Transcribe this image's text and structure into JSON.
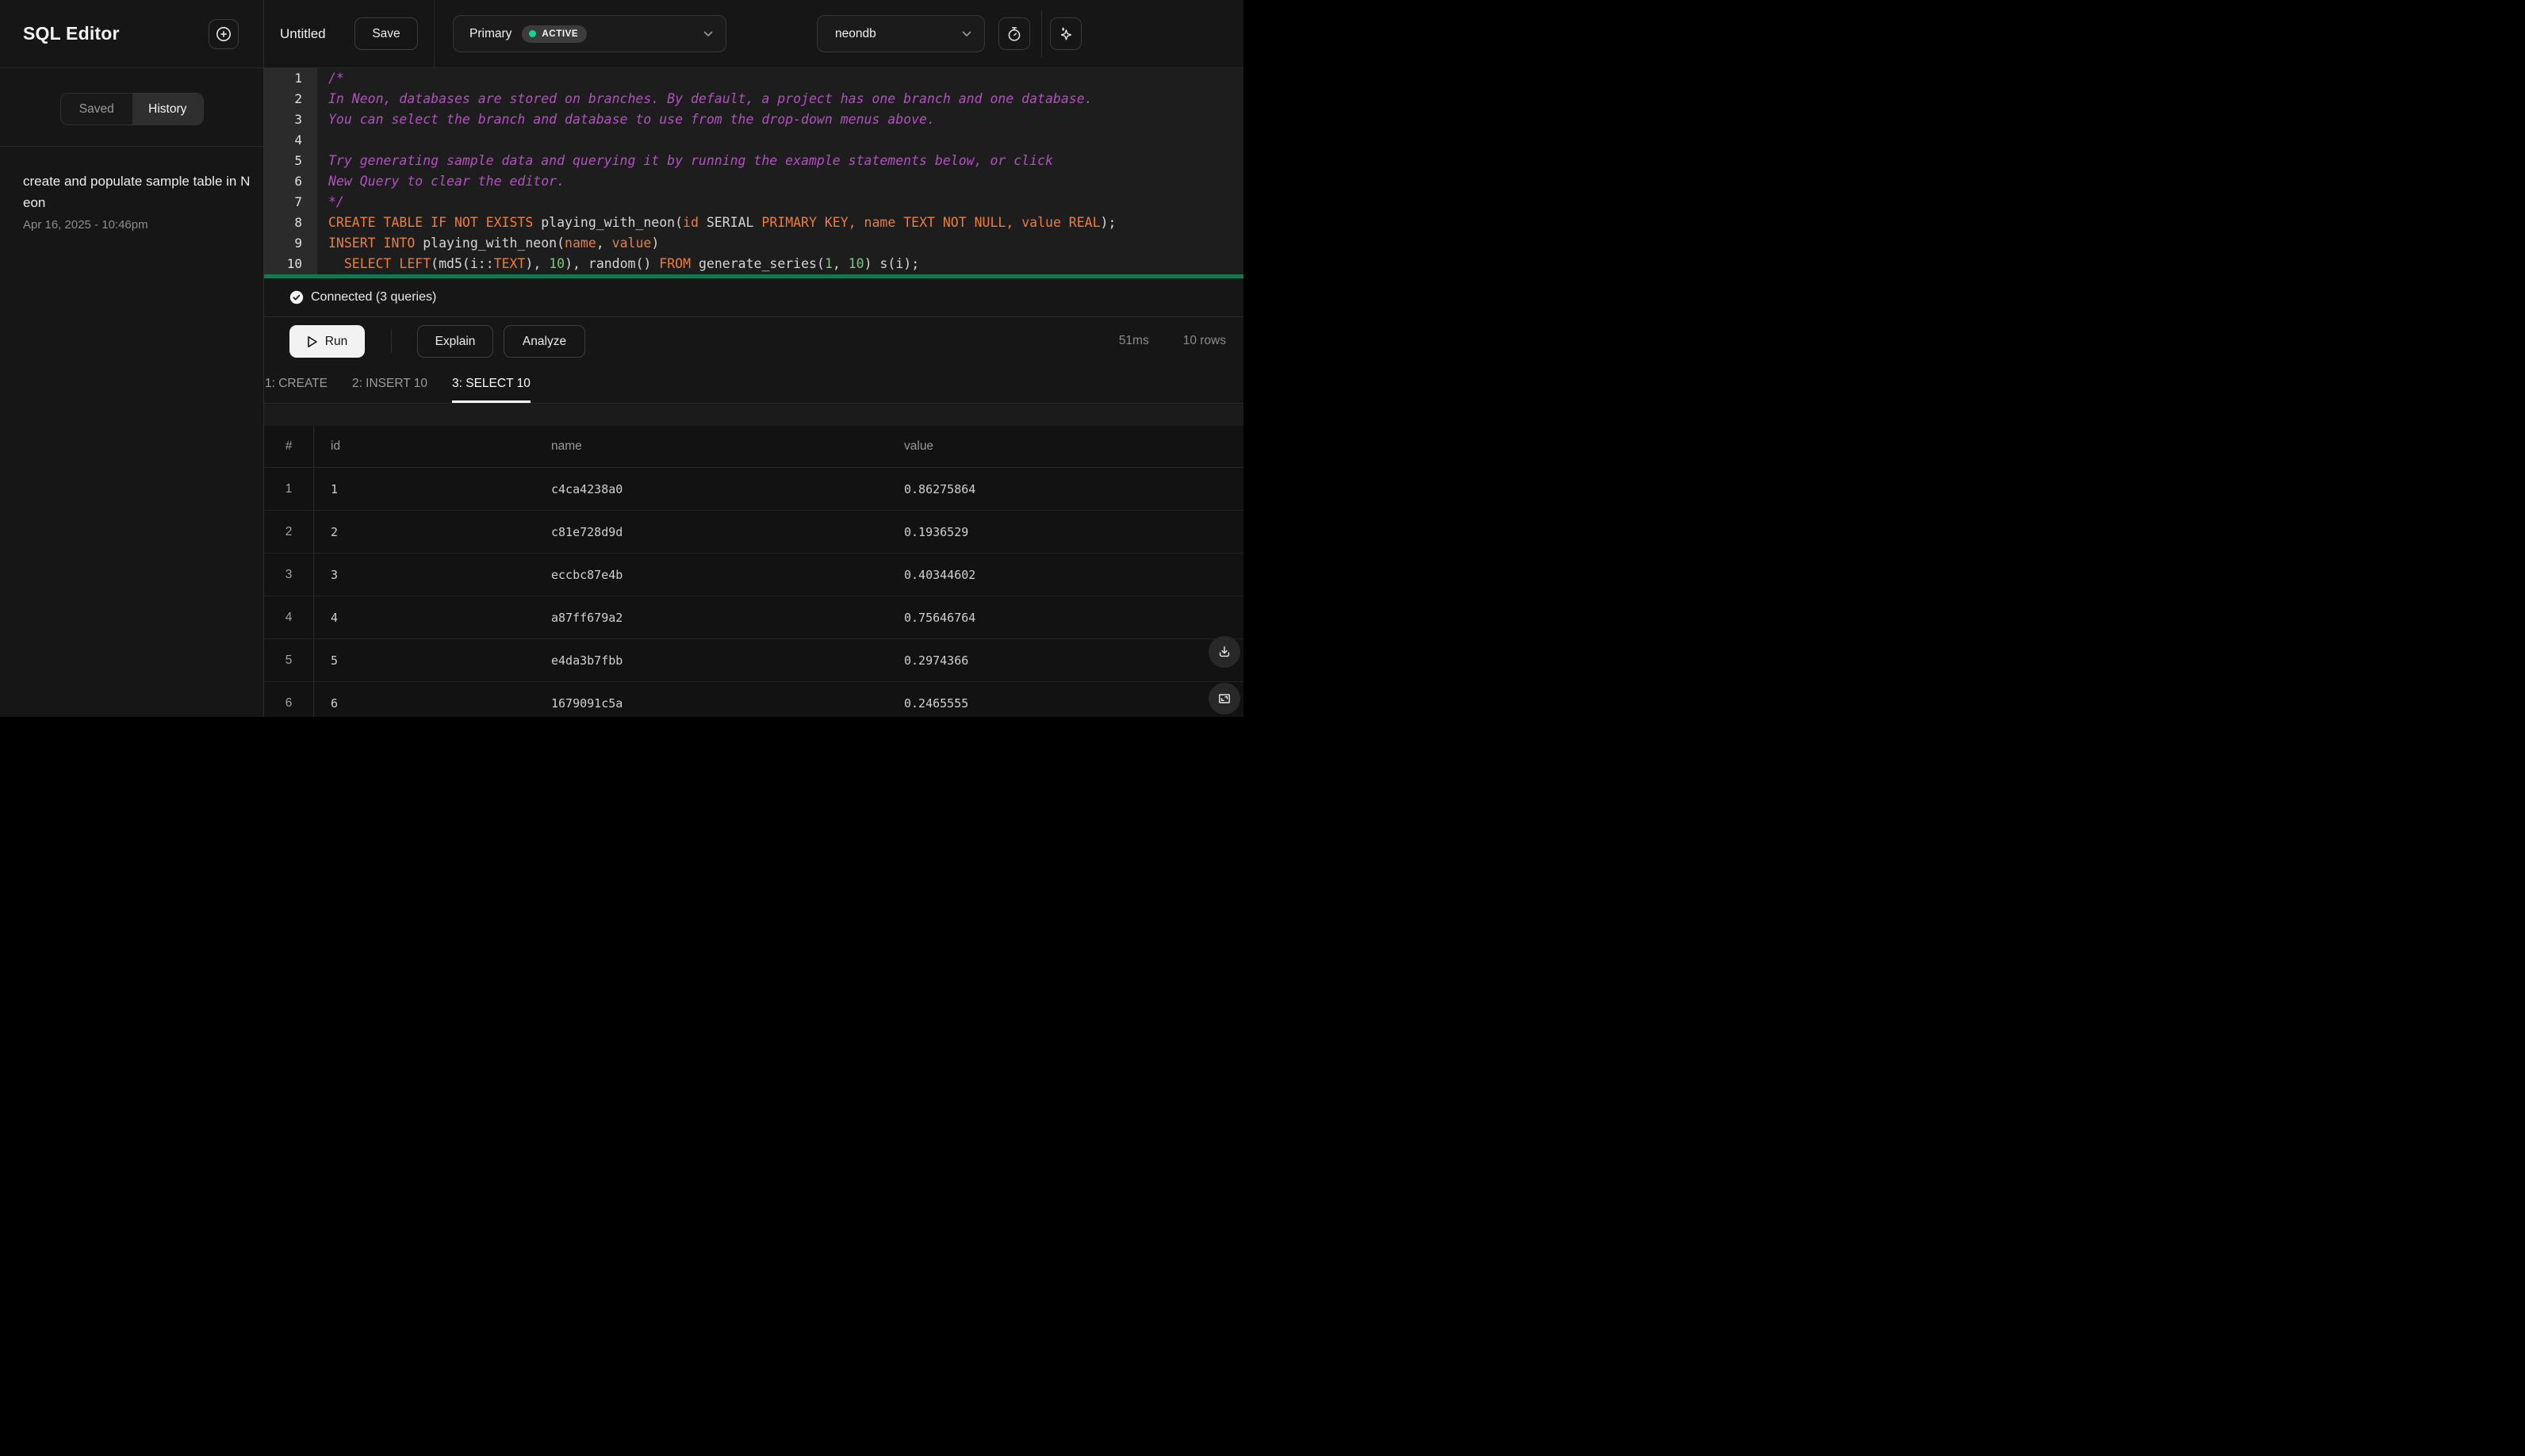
{
  "sidebar": {
    "title": "SQL Editor",
    "tabs": [
      {
        "label": "Saved",
        "active": false
      },
      {
        "label": "History",
        "active": true
      }
    ],
    "history_item": {
      "title": "create and populate sample table in Neon",
      "date": "Apr 16, 2025 - 10:46pm"
    }
  },
  "topbar": {
    "query_name": "Untitled",
    "save_label": "Save",
    "branch": {
      "name": "Primary",
      "status": "ACTIVE",
      "status_color": "#11d48d"
    },
    "database": {
      "name": "neondb"
    }
  },
  "editor": {
    "lines": [
      {
        "n": "1",
        "t": [
          [
            "c",
            "/*"
          ]
        ]
      },
      {
        "n": "2",
        "t": [
          [
            "c",
            "In Neon, databases are stored on branches. By default, a project has one branch and one database."
          ]
        ]
      },
      {
        "n": "3",
        "t": [
          [
            "c",
            "You can select the branch and database to use from the drop-down menus above."
          ]
        ]
      },
      {
        "n": "4",
        "t": []
      },
      {
        "n": "5",
        "t": [
          [
            "c",
            "Try generating sample data and querying it by running the example statements below, or click"
          ]
        ]
      },
      {
        "n": "6",
        "t": [
          [
            "c",
            "New Query to clear the editor."
          ]
        ]
      },
      {
        "n": "7",
        "t": [
          [
            "c",
            "*/"
          ]
        ]
      },
      {
        "n": "8",
        "t": [
          [
            "k",
            "CREATE TABLE IF NOT EXISTS"
          ],
          [
            "p",
            " playing_with_neon("
          ],
          [
            "k",
            "id"
          ],
          [
            "p",
            " SERIAL "
          ],
          [
            "k",
            "PRIMARY KEY, name TEXT NOT NULL, value REAL"
          ],
          [
            "p",
            ");"
          ]
        ]
      },
      {
        "n": "9",
        "t": [
          [
            "k",
            "INSERT INTO"
          ],
          [
            "p",
            " playing_with_neon("
          ],
          [
            "k",
            "name"
          ],
          [
            "p",
            ", "
          ],
          [
            "k",
            "value"
          ],
          [
            "p",
            ")"
          ]
        ]
      },
      {
        "n": "10",
        "t": [
          [
            "p",
            "  "
          ],
          [
            "k",
            "SELECT LEFT"
          ],
          [
            "p",
            "(md5(i::"
          ],
          [
            "k",
            "TEXT"
          ],
          [
            "p",
            "), "
          ],
          [
            "n",
            "10"
          ],
          [
            "p",
            "), random() "
          ],
          [
            "k",
            "FROM"
          ],
          [
            "p",
            " generate_series("
          ],
          [
            "n",
            "1"
          ],
          [
            "p",
            ", "
          ],
          [
            "n",
            "10"
          ],
          [
            "p",
            ") s(i);"
          ]
        ]
      }
    ],
    "syntax_colors": {
      "comment": "#b44fc2",
      "keyword": "#ed7d3a",
      "number": "#7dc87d",
      "plain": "#d6d6d6",
      "success_bar": "#157652"
    }
  },
  "status": {
    "connected": "Connected (3 queries)"
  },
  "actions": {
    "run_label": "Run",
    "explain_label": "Explain",
    "analyze_label": "Analyze",
    "duration": "51ms",
    "row_count": "10 rows"
  },
  "result_tabs": [
    {
      "label": "1: CREATE",
      "active": false
    },
    {
      "label": "2: INSERT 10",
      "active": false
    },
    {
      "label": "3: SELECT 10",
      "active": true
    }
  ],
  "table": {
    "columns": [
      "#",
      "id",
      "name",
      "value"
    ],
    "rows": [
      [
        "1",
        "1",
        "c4ca4238a0",
        "0.86275864"
      ],
      [
        "2",
        "2",
        "c81e728d9d",
        "0.1936529"
      ],
      [
        "3",
        "3",
        "eccbc87e4b",
        "0.40344602"
      ],
      [
        "4",
        "4",
        "a87ff679a2",
        "0.75646764"
      ],
      [
        "5",
        "5",
        "e4da3b7fbb",
        "0.2974366"
      ],
      [
        "6",
        "6",
        "1679091c5a",
        "0.2465555"
      ]
    ]
  }
}
